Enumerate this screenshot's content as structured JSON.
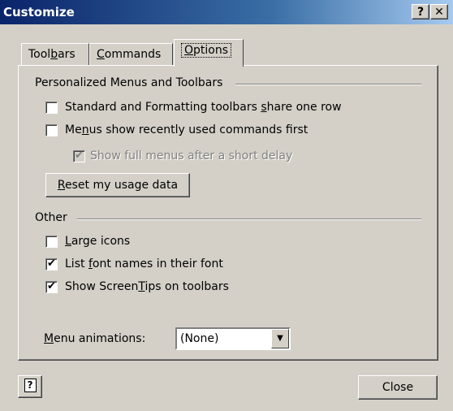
{
  "window": {
    "title": "Customize",
    "help_glyph": "?",
    "close_glyph": "✕"
  },
  "tabs": [
    {
      "pre": "Tool",
      "accel": "b",
      "post": "ars"
    },
    {
      "pre": "",
      "accel": "C",
      "post": "ommands"
    },
    {
      "pre": "",
      "accel": "O",
      "post": "ptions"
    }
  ],
  "group1": {
    "label": "Personalized Menus and Toolbars",
    "opt1": {
      "pre": "Standard and Formatting toolbars ",
      "accel": "s",
      "post": "hare one row",
      "checked": false
    },
    "opt2": {
      "pre": "Me",
      "accel": "n",
      "post": "us show recently used commands first",
      "checked": false
    },
    "opt3": {
      "pre": "Show full menus after a short delay",
      "accel": "",
      "post": "",
      "checked": true,
      "disabled": true
    },
    "reset": {
      "pre": "",
      "accel": "R",
      "post": "eset my usage data"
    }
  },
  "group2": {
    "label": "Other",
    "opt1": {
      "pre": "",
      "accel": "L",
      "post": "arge icons",
      "checked": false
    },
    "opt2": {
      "pre": "List ",
      "accel": "f",
      "post": "ont names in their font",
      "checked": true
    },
    "opt3": {
      "pre": "Show Screen",
      "accel": "T",
      "post": "ips on toolbars",
      "checked": true
    }
  },
  "animations": {
    "label_pre": "",
    "label_accel": "M",
    "label_post": "enu animations:",
    "value": "(None)"
  },
  "footer": {
    "help_icon_glyph": "?",
    "close_label": "Close"
  }
}
